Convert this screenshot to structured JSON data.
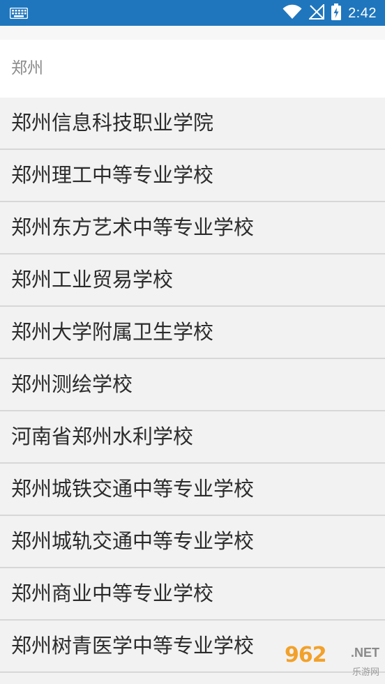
{
  "status_bar": {
    "time": "2:42",
    "icons": {
      "left": "keyboard-icon",
      "wifi": "wifi-icon",
      "signal": "signal-off-icon",
      "battery": "battery-charging-icon"
    },
    "background": "#1f76bd"
  },
  "search": {
    "value": "郑州"
  },
  "results": [
    {
      "label": "郑州信息科技职业学院"
    },
    {
      "label": "郑州理工中等专业学校"
    },
    {
      "label": "郑州东方艺术中等专业学校"
    },
    {
      "label": "郑州工业贸易学校"
    },
    {
      "label": "郑州大学附属卫生学校"
    },
    {
      "label": "郑州测绘学校"
    },
    {
      "label": "河南省郑州水利学校"
    },
    {
      "label": "郑州城铁交通中等专业学校"
    },
    {
      "label": "郑州城轨交通中等专业学校"
    },
    {
      "label": "郑州商业中等专业学校"
    },
    {
      "label": "郑州树青医学中等专业学校"
    }
  ],
  "watermark": {
    "logo": "962",
    "net": ".NET",
    "subtitle": "乐游网"
  }
}
